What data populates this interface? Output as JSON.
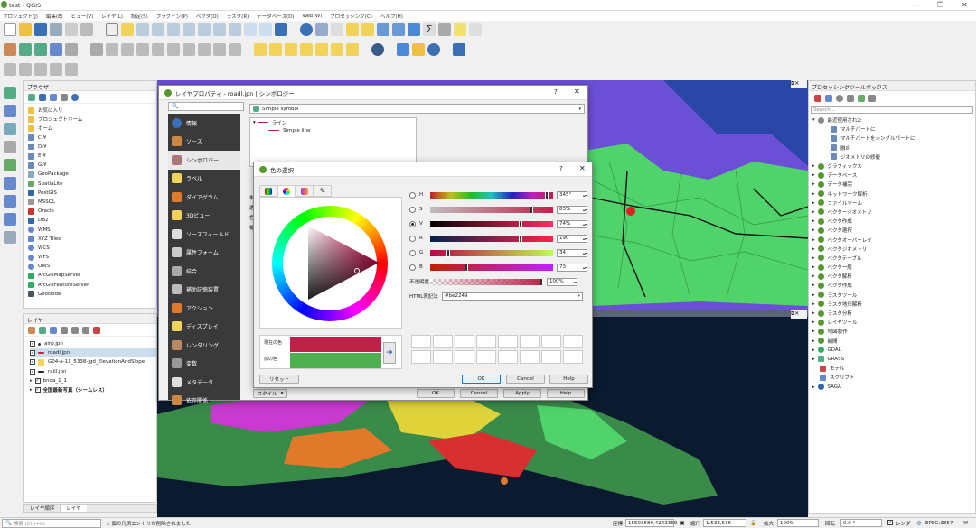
{
  "window": {
    "title": "test - QGIS",
    "controls": [
      "—",
      "❐",
      "✕"
    ]
  },
  "menubar": [
    "プロジェクト(J)",
    "編集(E)",
    "ビュー(V)",
    "レイヤ(L)",
    "設定(S)",
    "プラグイン(P)",
    "ベクタ(O)",
    "ラスタ(R)",
    "データベース(D)",
    "Web(W)",
    "プロセッシング(C)",
    "ヘルプ(H)"
  ],
  "browser": {
    "title": "ブラウザ",
    "items": [
      "お気に入り",
      "プロジェクトホーム",
      "ホーム",
      "C:¥",
      "D:¥",
      "E:¥",
      "G:¥",
      "GeoPackage",
      "SpatiaLite",
      "PostGIS",
      "MSSQL",
      "Oracle",
      "DB2",
      "WMS",
      "XYZ Tiles",
      "WCS",
      "WFS",
      "OWS",
      "ArcGisMapServer",
      "ArcGisFeatureServer",
      "GeoNode"
    ]
  },
  "layers": {
    "title": "レイヤ",
    "items": [
      "airp.jpn",
      "roadl.jpn",
      "G04-a-11_5338-jgd_ElevationAndSlope",
      "raill.jpn",
      "bnda_1_1",
      "全国最新写真（シームレス）"
    ]
  },
  "bottom_tabs": [
    "レイヤ順序",
    "レイヤ"
  ],
  "layer_props": {
    "title": "レイヤプロパティ - roadl.jpn | シンボロジー",
    "symbol_mode": "Simple symbol",
    "tree": [
      "ライン",
      "Simple line"
    ],
    "tabs": [
      "情報",
      "ソース",
      "シンボロジー",
      "ラベル",
      "ダイアグラム",
      "3Dビュー",
      "ソースフィールド",
      "属性フォーム",
      "結合",
      "補助記憶装置",
      "アクション",
      "ディスプレイ",
      "レンダリング",
      "変数",
      "メタデータ",
      "依存関係"
    ],
    "style_btn": "スタイル",
    "buttons": [
      "OK",
      "Cancel",
      "Apply",
      "Help"
    ],
    "side_labels": [
      "単",
      "透",
      "色",
      "幅"
    ]
  },
  "color_dialog": {
    "title": "色の選択",
    "help": "?",
    "close": "✕",
    "channels": [
      {
        "label": "H",
        "value": "345°",
        "fraction": 0.96
      },
      {
        "label": "S",
        "value": "83%",
        "fraction": 0.83
      },
      {
        "label": "V",
        "value": "74%",
        "fraction": 0.74
      },
      {
        "label": "R",
        "value": "190",
        "fraction": 0.745
      },
      {
        "label": "G",
        "value": "34",
        "fraction": 0.133
      },
      {
        "label": "B",
        "value": "73",
        "fraction": 0.286
      }
    ],
    "selected_channel": "V",
    "opacity_label": "不透明度",
    "opacity_value": "100%",
    "html_label": "HTML表記法",
    "html_value": "#be2249",
    "current_label": "現在の色",
    "previous_label": "前の色",
    "current_color": "#be2249",
    "previous_color": "#4caf50",
    "buttons": {
      "reset": "リセット",
      "ok": "OK",
      "cancel": "Cancel",
      "help": "Help"
    }
  },
  "processing": {
    "title": "プロセッシングツールボックス",
    "search_placeholder": "Search...",
    "recent": "最近使用された",
    "recent_items": [
      "マルチパートに",
      "マルチパートをシングルパートに",
      "融合",
      "ジオメトリの修復"
    ],
    "groups": [
      "グラフィックス",
      "データベース",
      "データ補完",
      "ネットワーク解析",
      "ファイルツール",
      "ベクタージオメトリ",
      "ベクタ作成",
      "ベクタ選択",
      "ベクタオーバーレイ",
      "ベクタジオメトリ",
      "ベクタテーブル",
      "ベクタ一般",
      "ベクタ解析",
      "ベクタ作成",
      "ラスタツール",
      "ラスタ地形解析",
      "ラスタ分析",
      "レイヤツール",
      "地図製作",
      "補間",
      "GDAL",
      "GRASS",
      "モデル",
      "スクリプト",
      "SAGA"
    ]
  },
  "statusbar": {
    "search_placeholder": "検索 (Ctrl+K)",
    "message": "1 個の凡例エントリが削除されました",
    "coord_label": "座標",
    "coord_value": "15503589,4243369",
    "scale_label": "縮尺",
    "scale_value": "1:533,516",
    "magnifier_label": "拡大",
    "magnifier_value": "100%",
    "rotation_label": "回転",
    "rotation_value": "0.0 °",
    "render_label": "レンダ",
    "crs": "EPSG:3857"
  },
  "colors": {
    "accent": "#be2249",
    "dialog_tabs_bg": "#3a3a3a",
    "selected_tab": "#e8e8e8"
  }
}
